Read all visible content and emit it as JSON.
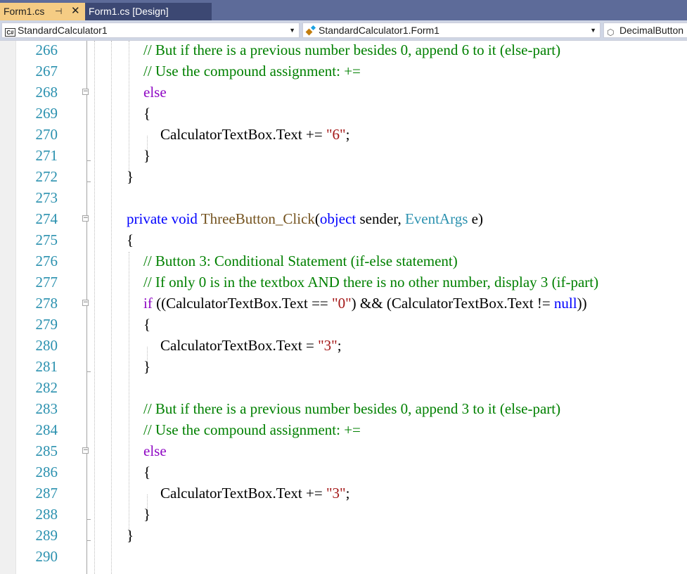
{
  "tabs": [
    {
      "label": "Form1.cs",
      "pin_icon": "pin-icon",
      "close_icon": "close-icon",
      "active": true
    },
    {
      "label": "Form1.cs [Design]",
      "active": false
    }
  ],
  "navbar": {
    "project": "StandardCalculator1",
    "type": "StandardCalculator1.Form1",
    "member": "DecimalButton"
  },
  "colors": {
    "comment": "#008000",
    "keyword": "#0000ff",
    "control_keyword": "#8f08c4",
    "string": "#a31515",
    "method": "#74531f",
    "type": "#2b91af",
    "line_number": "#2b91af",
    "active_tab": "#f5cc84",
    "tab_strip": "#5d6b99"
  },
  "code_lines": [
    {
      "n": "266",
      "indent": 2,
      "fold": null,
      "end": false,
      "tokens": [
        [
          "comment",
          "// But if there is a previous number besides 0, append 6 to it (else-part)"
        ]
      ]
    },
    {
      "n": "267",
      "indent": 2,
      "fold": null,
      "end": false,
      "tokens": [
        [
          "comment",
          "// Use the compound assignment: +="
        ]
      ]
    },
    {
      "n": "268",
      "indent": 2,
      "fold": "minus",
      "end": false,
      "tokens": [
        [
          "control",
          "else"
        ]
      ]
    },
    {
      "n": "269",
      "indent": 2,
      "fold": null,
      "end": false,
      "tokens": [
        [
          "plain",
          "{"
        ]
      ]
    },
    {
      "n": "270",
      "indent": 3,
      "fold": null,
      "end": false,
      "tokens": [
        [
          "plain",
          "CalculatorTextBox.Text += "
        ],
        [
          "string",
          "\"6\""
        ],
        [
          "plain",
          ";"
        ]
      ]
    },
    {
      "n": "271",
      "indent": 2,
      "fold": null,
      "end": true,
      "tokens": [
        [
          "plain",
          "}"
        ]
      ]
    },
    {
      "n": "272",
      "indent": 1,
      "fold": null,
      "end": true,
      "tokens": [
        [
          "plain",
          "}"
        ]
      ]
    },
    {
      "n": "273",
      "indent": 0,
      "fold": null,
      "end": false,
      "tokens": []
    },
    {
      "n": "274",
      "indent": 1,
      "fold": "minus",
      "end": false,
      "tokens": [
        [
          "keyword",
          "private"
        ],
        [
          "plain",
          " "
        ],
        [
          "keyword",
          "void"
        ],
        [
          "plain",
          " "
        ],
        [
          "method",
          "ThreeButton_Click"
        ],
        [
          "plain",
          "("
        ],
        [
          "keyword",
          "object"
        ],
        [
          "plain",
          " sender, "
        ],
        [
          "type",
          "EventArgs"
        ],
        [
          "plain",
          " e)"
        ]
      ]
    },
    {
      "n": "275",
      "indent": 1,
      "fold": null,
      "end": false,
      "tokens": [
        [
          "plain",
          "{"
        ]
      ]
    },
    {
      "n": "276",
      "indent": 2,
      "fold": null,
      "end": false,
      "tokens": [
        [
          "comment",
          "// Button 3: Conditional Statement (if-else statement)"
        ]
      ]
    },
    {
      "n": "277",
      "indent": 2,
      "fold": null,
      "end": false,
      "tokens": [
        [
          "comment",
          "// If only 0 is in the textbox AND there is no other number, display 3 (if-part)"
        ]
      ]
    },
    {
      "n": "278",
      "indent": 2,
      "fold": "minus",
      "end": false,
      "tokens": [
        [
          "control",
          "if"
        ],
        [
          "plain",
          " ((CalculatorTextBox.Text == "
        ],
        [
          "string",
          "\"0\""
        ],
        [
          "plain",
          ") && (CalculatorTextBox.Text != "
        ],
        [
          "keyword",
          "null"
        ],
        [
          "plain",
          "))"
        ]
      ]
    },
    {
      "n": "279",
      "indent": 2,
      "fold": null,
      "end": false,
      "tokens": [
        [
          "plain",
          "{"
        ]
      ]
    },
    {
      "n": "280",
      "indent": 3,
      "fold": null,
      "end": false,
      "tokens": [
        [
          "plain",
          "CalculatorTextBox.Text = "
        ],
        [
          "string",
          "\"3\""
        ],
        [
          "plain",
          ";"
        ]
      ]
    },
    {
      "n": "281",
      "indent": 2,
      "fold": null,
      "end": true,
      "tokens": [
        [
          "plain",
          "}"
        ]
      ]
    },
    {
      "n": "282",
      "indent": 0,
      "fold": null,
      "end": false,
      "tokens": []
    },
    {
      "n": "283",
      "indent": 2,
      "fold": null,
      "end": false,
      "tokens": [
        [
          "comment",
          "// But if there is a previous number besides 0, append 3 to it (else-part)"
        ]
      ]
    },
    {
      "n": "284",
      "indent": 2,
      "fold": null,
      "end": false,
      "tokens": [
        [
          "comment",
          "// Use the compound assignment: +="
        ]
      ]
    },
    {
      "n": "285",
      "indent": 2,
      "fold": "minus",
      "end": false,
      "tokens": [
        [
          "control",
          "else"
        ]
      ]
    },
    {
      "n": "286",
      "indent": 2,
      "fold": null,
      "end": false,
      "tokens": [
        [
          "plain",
          "{"
        ]
      ]
    },
    {
      "n": "287",
      "indent": 3,
      "fold": null,
      "end": false,
      "tokens": [
        [
          "plain",
          "CalculatorTextBox.Text += "
        ],
        [
          "string",
          "\"3\""
        ],
        [
          "plain",
          ";"
        ]
      ]
    },
    {
      "n": "288",
      "indent": 2,
      "fold": null,
      "end": true,
      "tokens": [
        [
          "plain",
          "}"
        ]
      ]
    },
    {
      "n": "289",
      "indent": 1,
      "fold": null,
      "end": true,
      "tokens": [
        [
          "plain",
          "}"
        ]
      ]
    },
    {
      "n": "290",
      "indent": 0,
      "fold": null,
      "end": false,
      "tokens": []
    }
  ]
}
